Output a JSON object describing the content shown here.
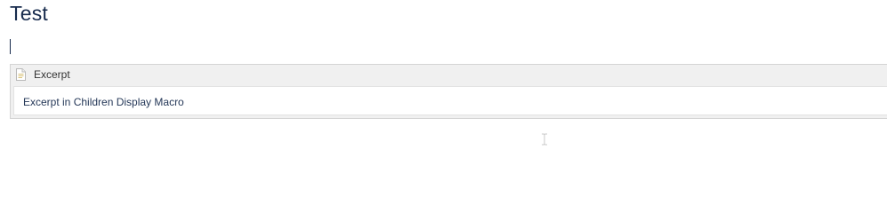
{
  "page": {
    "title": "Test"
  },
  "macro": {
    "icon": "document-icon",
    "title": "Excerpt",
    "body_text": "Excerpt in Children Display Macro"
  },
  "cursor": {
    "icon": "i-beam-cursor-icon"
  }
}
